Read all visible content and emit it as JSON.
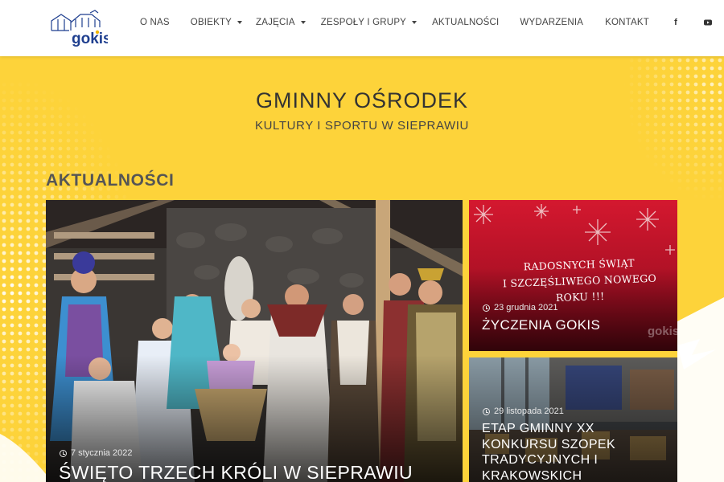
{
  "header": {
    "logo_text": "gokis",
    "nav": [
      {
        "label": "O NAS",
        "dropdown": false
      },
      {
        "label": "OBIEKTY",
        "dropdown": true
      },
      {
        "label": "ZAJĘCIA",
        "dropdown": true
      },
      {
        "label": "ZESPOŁY I GRUPY",
        "dropdown": true
      },
      {
        "label": "AKTUALNOŚCI",
        "dropdown": false
      },
      {
        "label": "WYDARZENIA",
        "dropdown": false
      },
      {
        "label": "KONTAKT",
        "dropdown": false
      }
    ],
    "social": [
      {
        "icon": "facebook-icon",
        "glyph": "f"
      },
      {
        "icon": "youtube-icon",
        "glyph": "▶"
      }
    ]
  },
  "hero": {
    "title": "GMINNY OŚRODEK",
    "subtitle": "KULTURY I SPORTU W SIEPRAWIU"
  },
  "news": {
    "heading": "AKTUALNOŚCI",
    "items": [
      {
        "date": "7 stycznia 2022",
        "title": "ŚWIĘTO TRZECH KRÓLI W SIEPRAWIU"
      },
      {
        "date": "23 grudnia 2021",
        "title": "ŻYCZENIA GOKIS",
        "image_text": "RADOSNYCH ŚWIĄT\nI SZCZĘŚLIWEGO NOWEGO ROKU !!!"
      },
      {
        "date": "29 listopada 2021",
        "title": "ETAP GMINNY XX KONKURSU SZOPEK TRADYCYJNYCH I KRAKOWSKICH"
      }
    ]
  },
  "colors": {
    "background": "#fdd33a",
    "header_bg": "#ffffff",
    "xmas_red": "#c8102e",
    "logo_blue": "#1f3f8f",
    "logo_yellow": "#f2b705"
  }
}
